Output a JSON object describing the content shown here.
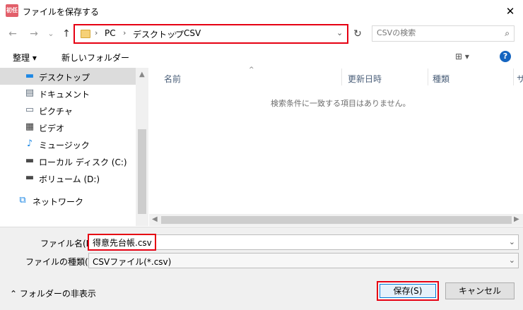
{
  "window": {
    "icon_text": "初任",
    "title": "ファイルを保存する",
    "close": "✕"
  },
  "nav": {
    "back": "←",
    "forward": "→",
    "recent": "⌄",
    "up": "↑",
    "refresh": "↻"
  },
  "address": {
    "crumbs": [
      "PC",
      "デスクトップ",
      "CSV"
    ],
    "separator": "›",
    "dropdown": "⌄"
  },
  "search": {
    "placeholder": "CSVの検索",
    "icon": "⌕"
  },
  "toolbar": {
    "organize": "整理 ▾",
    "new_folder": "新しいフォルダー",
    "view": "⊞ ▾",
    "help": "?"
  },
  "sidebar": {
    "items": [
      {
        "label": "デスクトップ",
        "icon": "desktop-icon",
        "glyph": "▬",
        "color": "#1e88e5"
      },
      {
        "label": "ドキュメント",
        "icon": "document-icon",
        "glyph": "▤",
        "color": "#5c6b7a"
      },
      {
        "label": "ピクチャ",
        "icon": "pictures-icon",
        "glyph": "▭",
        "color": "#5c6b7a"
      },
      {
        "label": "ビデオ",
        "icon": "video-icon",
        "glyph": "▦",
        "color": "#333333"
      },
      {
        "label": "ミュージック",
        "icon": "music-icon",
        "glyph": "♪",
        "color": "#1e88e5"
      },
      {
        "label": "ローカル ディスク (C:)",
        "icon": "local-disk-icon",
        "glyph": "▬",
        "color": "#4a4a4a"
      },
      {
        "label": "ボリューム (D:)",
        "icon": "volume-icon",
        "glyph": "▬",
        "color": "#4a4a4a"
      },
      {
        "label": "ネットワーク",
        "icon": "network-icon",
        "glyph": "⧉",
        "color": "#1e88e5"
      }
    ]
  },
  "filelist": {
    "columns": [
      "名前",
      "更新日時",
      "種類",
      "サ"
    ],
    "sort_arrow": "^",
    "empty_message": "検索条件に一致する項目はありません。"
  },
  "form": {
    "filename_label": "ファイル名(N):",
    "filename_value": "得意先台帳.csv",
    "filetype_label": "ファイルの種類(T):",
    "filetype_value": "CSVファイル(*.csv)",
    "dropdown": "⌄"
  },
  "footer": {
    "hide_folders": "⌃ フォルダーの非表示",
    "save": "保存(S)",
    "cancel": "キャンセル"
  },
  "colors": {
    "highlight": "#e60012",
    "accent": "#0078d7"
  }
}
